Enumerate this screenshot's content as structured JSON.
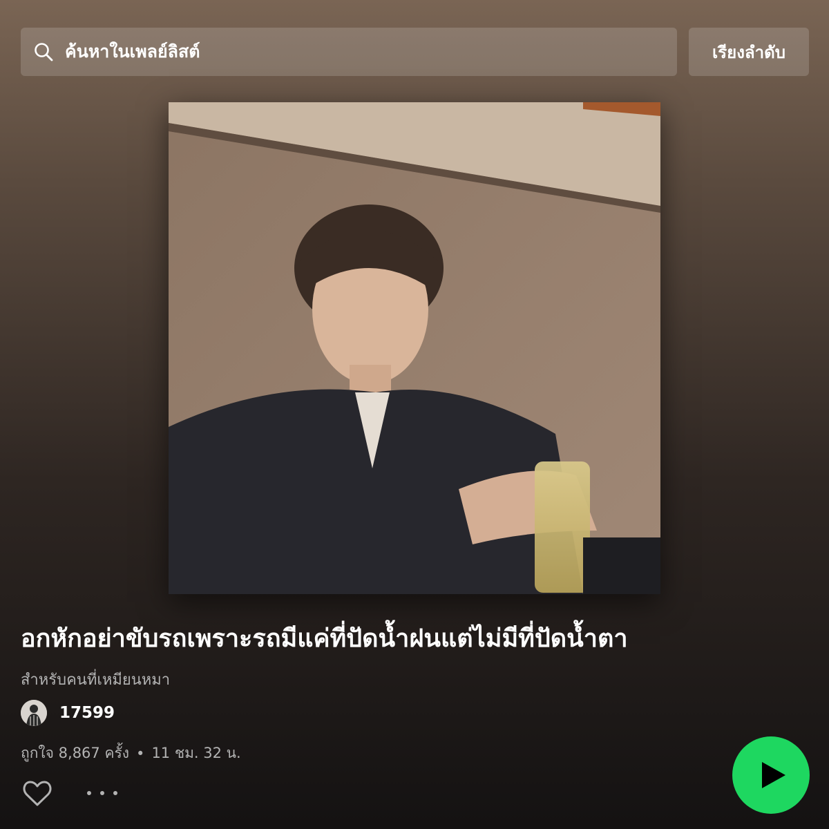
{
  "search": {
    "placeholder": "ค้นหาในเพลย์ลิสต์",
    "icon": "search-icon"
  },
  "sort_button": {
    "label": "เรียงลำดับ"
  },
  "playlist": {
    "title": "อกหักอย่าขับรถเพราะรถมีแค่ที่ปัดน้ำฝนแต่ไม่มีที่ปัดน้ำตา",
    "description": "สำหรับคนที่เหมียนหมา",
    "owner": "17599",
    "likes_text": "ถูกใจ 8,867 ครั้ง",
    "separator": "•",
    "duration": "11 ชม. 32 น."
  },
  "actions": {
    "like_icon": "heart-icon",
    "more_icon": "more-options-icon",
    "play_icon": "play-icon",
    "play_color": "#1ed760"
  }
}
